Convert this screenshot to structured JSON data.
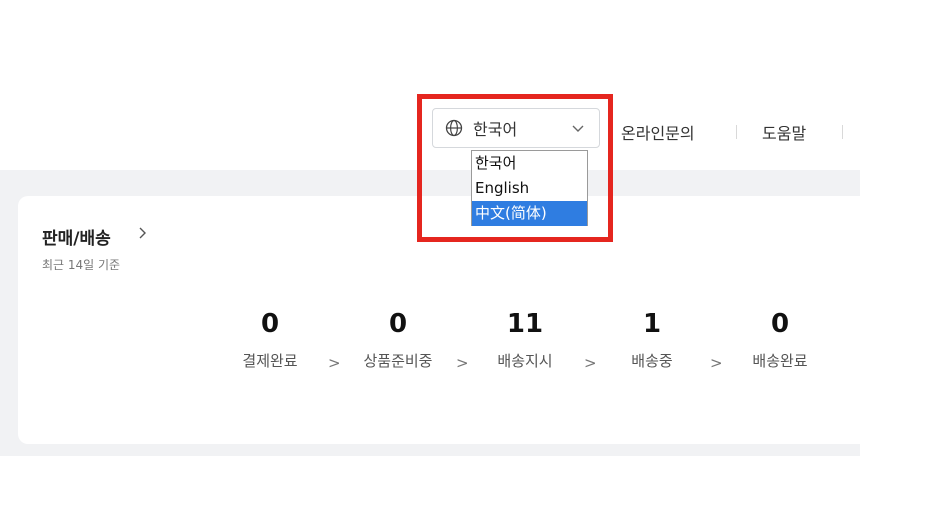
{
  "header": {
    "language_select": {
      "value": "한국어",
      "icon": "globe-icon",
      "chevron_icon": "chevron-down-icon"
    },
    "dropdown_options": [
      {
        "label": "한국어",
        "selected": false
      },
      {
        "label": "English",
        "selected": false
      },
      {
        "label": "中文(简体)",
        "selected": true
      }
    ],
    "links": [
      {
        "label": "온라인문의"
      },
      {
        "label": "도움말"
      }
    ]
  },
  "card": {
    "title": "판매/배송",
    "subtitle": "최근 14일 기준",
    "steps": [
      {
        "value": "0",
        "label": "결제완료"
      },
      {
        "value": "0",
        "label": "상품준비중"
      },
      {
        "value": "11",
        "label": "배송지시"
      },
      {
        "value": "1",
        "label": "배송중"
      },
      {
        "value": "0",
        "label": "배송완료"
      }
    ],
    "step_separator": ">"
  },
  "colors": {
    "highlight": "#e5261f",
    "selected_option": "#2f7de1",
    "content_background": "#f1f2f4"
  }
}
